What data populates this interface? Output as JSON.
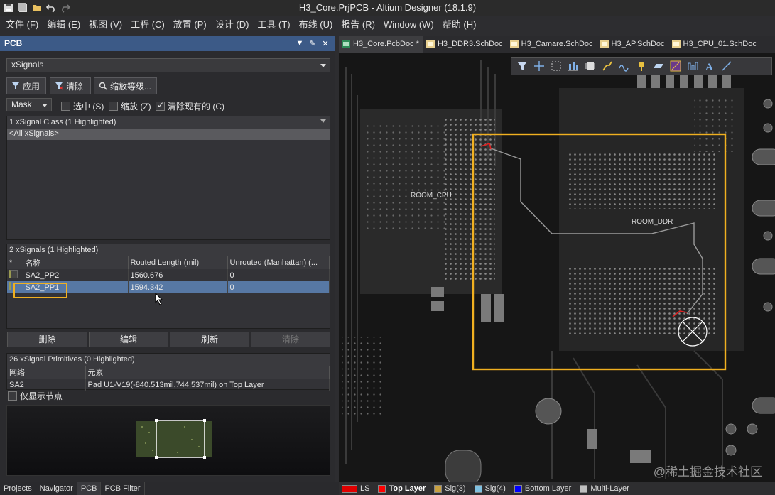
{
  "title_bar": {
    "title": "H3_Core.PrjPCB - Altium Designer (18.1.9)",
    "quick_access": [
      "save-icon",
      "save-all-icon",
      "open-folder-icon",
      "undo-icon",
      "redo-icon"
    ]
  },
  "menu": {
    "items": [
      "文件 (F)",
      "编辑 (E)",
      "视图 (V)",
      "工程 (C)",
      "放置 (P)",
      "设计 (D)",
      "工具 (T)",
      "布线 (U)",
      "报告 (R)",
      "Window (W)",
      "帮助 (H)"
    ]
  },
  "panel": {
    "title": "PCB",
    "object_type": "xSignals",
    "apply_label": "应用",
    "clear_label": "清除",
    "zoom_label": "缩放等级...",
    "mode": "Mask",
    "select_label": "选中 (S)",
    "zoom_chk_label": "缩放 (Z)",
    "clear_existing_label": "清除现有的 (C)",
    "class_list": {
      "title": "1 xSignal Class (1 Highlighted)",
      "items": [
        "<All xSignals>"
      ]
    },
    "signal_table": {
      "title": "2 xSignals (1 Highlighted)",
      "columns": [
        "*",
        "名称",
        "Routed Length (mil)",
        "Unrouted (Manhattan) (..."
      ],
      "rows": [
        {
          "name": "SA2_PP2",
          "routed": "1560.676",
          "unrouted": "0"
        },
        {
          "name": "SA2_PP1",
          "routed": "1594.342",
          "unrouted": "0"
        }
      ]
    },
    "buttons": {
      "delete": "删除",
      "edit": "编辑",
      "refresh": "刷新",
      "clear": "清除"
    },
    "primitives": {
      "title": "26 xSignal Primitives (0 Highlighted)",
      "columns": [
        "网络",
        "元素"
      ],
      "rows": [
        {
          "net": "SA2",
          "element": "Pad U1-V19(-840.513mil,744.537mil) on Top Layer"
        }
      ]
    },
    "only_nodes_label": "仅显示节点"
  },
  "bottom_tabs": [
    "Projects",
    "Navigator",
    "PCB",
    "PCB Filter"
  ],
  "doc_tabs": [
    {
      "label": "H3_Core.PcbDoc *",
      "active": true
    },
    {
      "label": "H3_DDR3.SchDoc",
      "active": false
    },
    {
      "label": "H3_Camare.SchDoc",
      "active": false
    },
    {
      "label": "H3_AP.SchDoc",
      "active": false
    },
    {
      "label": "H3_CPU_01.SchDoc",
      "active": false
    }
  ],
  "canvas": {
    "room_cpu": "ROOM_CPU",
    "room_ddr": "ROOM_DDR"
  },
  "layers": [
    {
      "name": "LS",
      "color": "#e00000"
    },
    {
      "name": "Top Layer",
      "color": "#ff0000",
      "active": true
    },
    {
      "name": "Sig(3)",
      "color": "#c8a040"
    },
    {
      "name": "Sig(4)",
      "color": "#80c0e0"
    },
    {
      "name": "Bottom Layer",
      "color": "#0000ff"
    },
    {
      "name": "Multi-Layer",
      "color": "#c0c0c0"
    }
  ],
  "watermark": "@稀土掘金技术社区",
  "colors": {
    "panel_header": "#3c5a87",
    "highlight_box": "#f0b020",
    "selected_row": "#5778a4"
  }
}
